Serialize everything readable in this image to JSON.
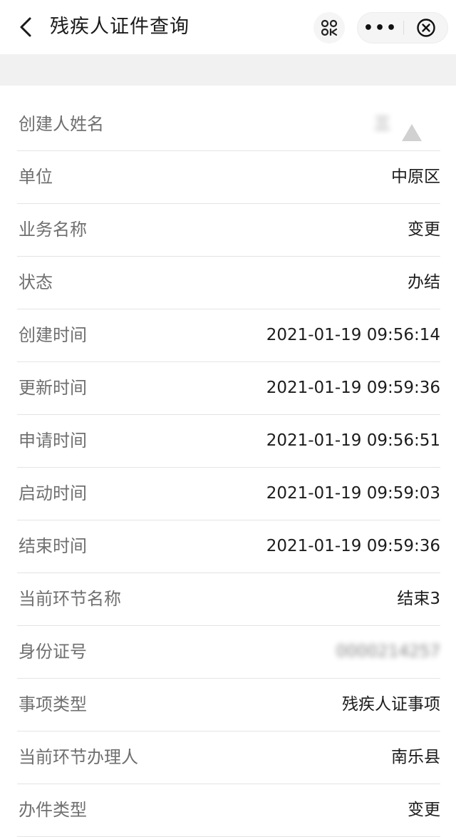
{
  "header": {
    "title": "残疾人证件查询",
    "more_label": "•••"
  },
  "rows": [
    {
      "label": "创建人姓名",
      "value": "三"
    },
    {
      "label": "单位",
      "value": "中原区"
    },
    {
      "label": "业务名称",
      "value": "变更"
    },
    {
      "label": "状态",
      "value": "办结"
    },
    {
      "label": "创建时间",
      "value": "2021-01-19 09:56:14"
    },
    {
      "label": "更新时间",
      "value": "2021-01-19 09:59:36"
    },
    {
      "label": "申请时间",
      "value": "2021-01-19 09:56:51"
    },
    {
      "label": "启动时间",
      "value": "2021-01-19 09:59:03"
    },
    {
      "label": "结束时间",
      "value": "2021-01-19 09:59:36"
    },
    {
      "label": "当前环节名称",
      "value": "结束3"
    },
    {
      "label": "身份证号",
      "value": "0000214257"
    },
    {
      "label": "事项类型",
      "value": "残疾人证事项"
    },
    {
      "label": "当前环节办理人",
      "value": "南乐县"
    },
    {
      "label": "办件类型",
      "value": "变更"
    }
  ]
}
